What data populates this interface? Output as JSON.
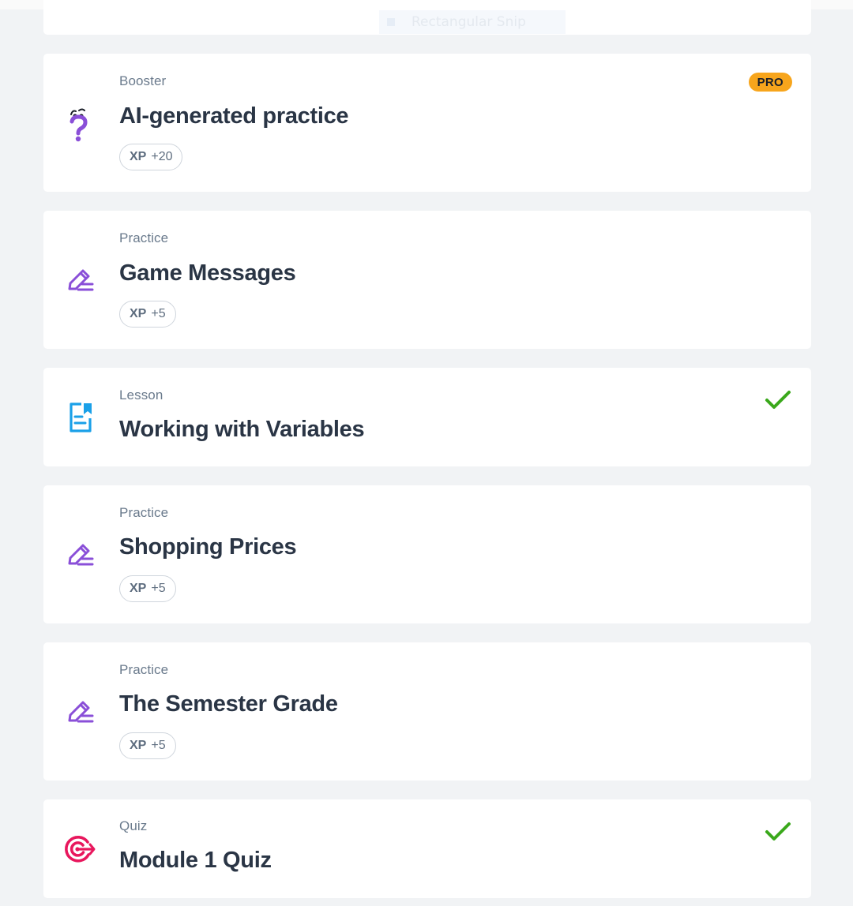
{
  "overlay": {
    "snip_label": "Rectangular Snip"
  },
  "cards": [
    {
      "type": "Booster",
      "title": "AI-generated practice",
      "xp_label": "XP",
      "xp_value": "+20",
      "badge": "PRO",
      "icon": "question-mark-icon"
    },
    {
      "type": "Practice",
      "title": "Game Messages",
      "xp_label": "XP",
      "xp_value": "+5",
      "icon": "pencil-icon"
    },
    {
      "type": "Lesson",
      "title": "Working with Variables",
      "completed": true,
      "icon": "document-bookmark-icon"
    },
    {
      "type": "Practice",
      "title": "Shopping Prices",
      "xp_label": "XP",
      "xp_value": "+5",
      "icon": "pencil-icon"
    },
    {
      "type": "Practice",
      "title": "The Semester Grade",
      "xp_label": "XP",
      "xp_value": "+5",
      "icon": "pencil-icon"
    },
    {
      "type": "Quiz",
      "title": "Module 1 Quiz",
      "completed": true,
      "icon": "target-icon"
    }
  ],
  "colors": {
    "background": "#f1f3f5",
    "card": "#ffffff",
    "practice_icon": "#8a4fd8",
    "lesson_icon": "#1aa0e8",
    "quiz_icon": "#e8175d",
    "check": "#3aa81b",
    "pro_badge": "#f7a51c",
    "title_text": "#2a3545",
    "type_text": "#6a7a8c"
  }
}
